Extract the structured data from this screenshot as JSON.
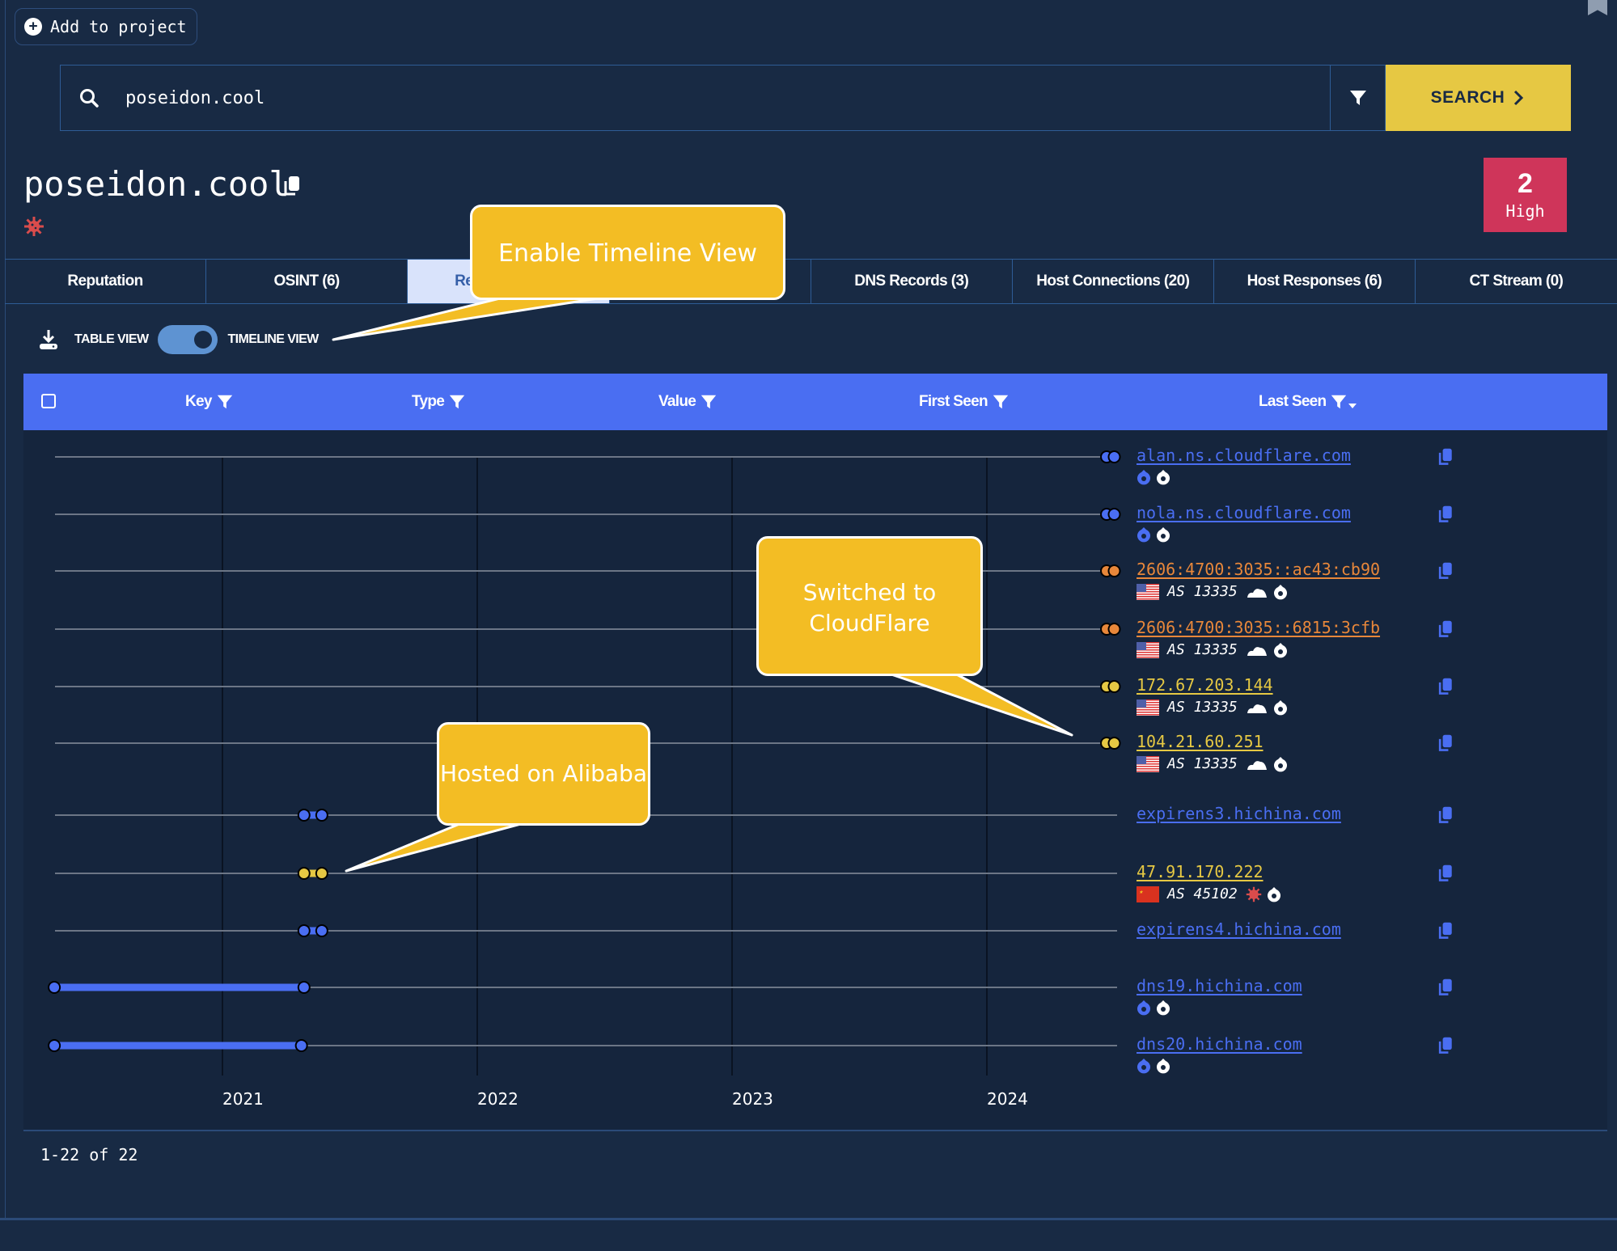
{
  "toolbar": {
    "add_to_project_label": "Add to project"
  },
  "search": {
    "value": "poseidon.cool",
    "button_label": "SEARCH"
  },
  "header": {
    "title": "poseidon.cool",
    "risk_count": "2",
    "risk_level": "High",
    "risk_color": "#cf355a"
  },
  "tabs": [
    {
      "label": "Reputation",
      "active": false
    },
    {
      "label": "OSINT (6)",
      "active": false
    },
    {
      "label": "Re",
      "active": true
    },
    {
      "label": "",
      "active": false
    },
    {
      "label": "DNS Records (3)",
      "active": false
    },
    {
      "label": "Host Connections (20)",
      "active": false
    },
    {
      "label": "Host Responses (6)",
      "active": false
    },
    {
      "label": "CT Stream (0)",
      "active": false
    }
  ],
  "view_toggle": {
    "left_label": "TABLE VIEW",
    "right_label": "TIMELINE VIEW",
    "timeline_enabled": true
  },
  "table": {
    "columns": [
      "Key",
      "Type",
      "Value",
      "First Seen",
      "Last Seen"
    ],
    "sorted_column": "Last Seen",
    "sort_direction": "desc"
  },
  "timeline": {
    "axis_years": [
      "2021",
      "2022",
      "2023",
      "2024"
    ],
    "rows": [
      {
        "value": "alan.ns.cloudflare.com",
        "kind": "hostname",
        "color": "#4a6ef2",
        "first_seen": 2024.47,
        "last_seen": 2024.5,
        "meta": {
          "icons": [
            "blue-badge-icon",
            "white-badge-icon"
          ]
        }
      },
      {
        "value": "nola.ns.cloudflare.com",
        "kind": "hostname",
        "color": "#4a6ef2",
        "first_seen": 2024.47,
        "last_seen": 2024.5,
        "meta": {
          "icons": [
            "blue-badge-icon",
            "white-badge-icon"
          ]
        }
      },
      {
        "value": "2606:4700:3035::ac43:cb90",
        "kind": "ipv6",
        "color": "#e8873a",
        "first_seen": 2024.47,
        "last_seen": 2024.5,
        "meta": {
          "country": "US",
          "asn": "AS 13335",
          "icons": [
            "cloud-icon",
            "white-badge-icon"
          ]
        }
      },
      {
        "value": "2606:4700:3035::6815:3cfb",
        "kind": "ipv6",
        "color": "#e8873a",
        "first_seen": 2024.47,
        "last_seen": 2024.5,
        "meta": {
          "country": "US",
          "asn": "AS 13335",
          "icons": [
            "cloud-icon",
            "white-badge-icon"
          ]
        }
      },
      {
        "value": "172.67.203.144",
        "kind": "ipv4",
        "color": "#e6c843",
        "first_seen": 2024.47,
        "last_seen": 2024.5,
        "meta": {
          "country": "US",
          "asn": "AS 13335",
          "icons": [
            "cloud-icon",
            "white-badge-icon"
          ]
        }
      },
      {
        "value": "104.21.60.251",
        "kind": "ipv4",
        "color": "#e6c843",
        "first_seen": 2024.47,
        "last_seen": 2024.5,
        "meta": {
          "country": "US",
          "asn": "AS 13335",
          "icons": [
            "cloud-icon",
            "white-badge-icon"
          ]
        }
      },
      {
        "value": "expirens3.hichina.com",
        "kind": "hostname",
        "color": "#4a6ef2",
        "first_seen": 2021.32,
        "last_seen": 2021.39,
        "meta": null
      },
      {
        "value": "47.91.170.222",
        "kind": "ipv4",
        "color": "#e6c843",
        "first_seen": 2021.32,
        "last_seen": 2021.39,
        "meta": {
          "country": "CN",
          "asn": "AS 45102",
          "icons": [
            "virus-icon",
            "white-badge-icon"
          ]
        }
      },
      {
        "value": "expirens4.hichina.com",
        "kind": "hostname",
        "color": "#4a6ef2",
        "first_seen": 2021.32,
        "last_seen": 2021.39,
        "meta": null
      },
      {
        "value": "dns19.hichina.com",
        "kind": "hostname",
        "color": "#4a6ef2",
        "first_seen": 2020.34,
        "last_seen": 2021.32,
        "meta": {
          "icons": [
            "blue-badge-icon",
            "white-badge-icon"
          ]
        }
      },
      {
        "value": "dns20.hichina.com",
        "kind": "hostname",
        "color": "#4a6ef2",
        "first_seen": 2020.34,
        "last_seen": 2021.31,
        "meta": {
          "icons": [
            "blue-badge-icon",
            "white-badge-icon"
          ]
        }
      }
    ]
  },
  "callouts": {
    "timeline_view": "Enable Timeline View",
    "cloudflare": [
      "Switched to",
      "CloudFlare"
    ],
    "alibaba": "Hosted on Alibaba"
  },
  "pagination": {
    "label": "1-22 of 22"
  },
  "colors": {
    "background": "#182a44",
    "accent_blue": "#4a6ef2",
    "search_yellow": "#e6c843",
    "callout_yellow": "#f3bd24",
    "ipv6_orange": "#e8873a"
  }
}
